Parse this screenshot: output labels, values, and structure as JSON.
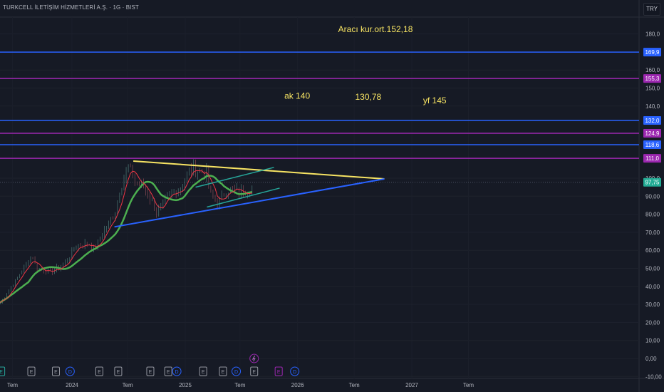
{
  "header": {
    "title": "TURKCELL İLETİŞİM HİZMETLERİ A.Ş. · 1G · BIST",
    "currency": "TRY"
  },
  "colors": {
    "background": "#161a25",
    "blue": "#2962ff",
    "purple": "#9c27b0",
    "yellow": "#f7e463",
    "green_line": "#26a69a",
    "ma_slow": "#4caf50",
    "ma_fast": "#f23645",
    "last_price": "#22ab94"
  },
  "chart_data": {
    "type": "candlestick",
    "time_unit": "months since 2023-01",
    "xlim": [
      -4.4,
      63.3
    ],
    "ylim": [
      -10,
      188
    ],
    "y_ticks": [
      "180,0",
      "160,0",
      "150,0",
      "140,0",
      "100,0",
      "90,00",
      "80,00",
      "70,00",
      "60,00",
      "50,00",
      "40,00",
      "30,00",
      "20,00",
      "10,00",
      "0,00",
      "-10,00"
    ],
    "y_tick_values": [
      180,
      160,
      150,
      140,
      100,
      90,
      80,
      70,
      60,
      50,
      40,
      30,
      20,
      10,
      0,
      -10
    ],
    "x_ticks": [
      {
        "label": "Tem",
        "t": 5.7
      },
      {
        "label": "2024",
        "t": 12
      },
      {
        "label": "Tem",
        "t": 17.9
      },
      {
        "label": "2025",
        "t": 24
      },
      {
        "label": "Tem",
        "t": 29.8
      },
      {
        "label": "2026",
        "t": 35.9
      },
      {
        "label": "Tem",
        "t": 41.9
      },
      {
        "label": "2027",
        "t": 48
      },
      {
        "label": "Tem",
        "t": 54
      }
    ],
    "price_path": [
      [
        4.4,
        31
      ],
      [
        7.8,
        57
      ],
      [
        8.2,
        50
      ],
      [
        9.7,
        48
      ],
      [
        11.2,
        52
      ],
      [
        12.3,
        62
      ],
      [
        13.8,
        64
      ],
      [
        14.4,
        60
      ],
      [
        15.3,
        70
      ],
      [
        16.5,
        80
      ],
      [
        17.2,
        96
      ],
      [
        18.0,
        107
      ],
      [
        18.7,
        98
      ],
      [
        19.5,
        96
      ],
      [
        20.6,
        86
      ],
      [
        21.0,
        80
      ],
      [
        21.7,
        86
      ],
      [
        22.5,
        91
      ],
      [
        23.6,
        95
      ],
      [
        24.4,
        104
      ],
      [
        25.1,
        105
      ],
      [
        26.3,
        102
      ],
      [
        26.6,
        92
      ],
      [
        27.4,
        86
      ],
      [
        28.5,
        94
      ],
      [
        30.0,
        92
      ],
      [
        31.2,
        95
      ]
    ],
    "horizontal_levels": [
      {
        "value": 169.9,
        "label": "169,9",
        "color": "#2962ff"
      },
      {
        "value": 155.3,
        "label": "155,3",
        "color": "#9c27b0"
      },
      {
        "value": 132.0,
        "label": "132,0",
        "color": "#2962ff"
      },
      {
        "value": 124.9,
        "label": "124,9",
        "color": "#9c27b0"
      },
      {
        "value": 118.6,
        "label": "118,6",
        "color": "#2962ff"
      },
      {
        "value": 111.0,
        "label": "111,0",
        "color": "#9c27b0"
      }
    ],
    "last_price": {
      "value": 97.75,
      "label": "97,75"
    },
    "trend_lines": [
      {
        "name": "resistance",
        "color": "#f7e463",
        "from": [
          18.5,
          109.5
        ],
        "to": [
          45.1,
          99.6
        ]
      },
      {
        "name": "support",
        "color": "#2962ff",
        "from": [
          16.5,
          73
        ],
        "to": [
          45.1,
          99.6
        ]
      },
      {
        "name": "channel-upper",
        "color": "#26a69a",
        "from": [
          25.1,
          95
        ],
        "to": [
          33.4,
          106
        ]
      },
      {
        "name": "channel-lower",
        "color": "#26a69a",
        "from": [
          26.3,
          84
        ],
        "to": [
          34.0,
          94.5
        ]
      }
    ],
    "annotations": [
      {
        "text": "Aracı kur.ort.152,18",
        "t": 40.2,
        "value": 181
      },
      {
        "text": "ak 140",
        "t": 34.5,
        "value": 144
      },
      {
        "text": "130,78",
        "t": 42.0,
        "value": 143.5
      },
      {
        "text": "yf 145",
        "t": 49.2,
        "value": 141.5
      }
    ],
    "events": [
      {
        "type": "E",
        "t": 4.5,
        "color": "#26a69a"
      },
      {
        "type": "E",
        "t": 7.7
      },
      {
        "type": "E",
        "t": 10.3
      },
      {
        "type": "D",
        "t": 11.8
      },
      {
        "type": "E",
        "t": 14.9
      },
      {
        "type": "E",
        "t": 16.9
      },
      {
        "type": "E",
        "t": 20.3
      },
      {
        "type": "E",
        "t": 22.2
      },
      {
        "type": "D",
        "t": 23.1
      },
      {
        "type": "E",
        "t": 25.9
      },
      {
        "type": "E",
        "t": 28.0
      },
      {
        "type": "D",
        "t": 29.4
      },
      {
        "type": "E",
        "t": 31.3
      },
      {
        "type": "E",
        "t": 33.9,
        "color": "#9c27b0"
      },
      {
        "type": "D",
        "t": 35.6
      }
    ],
    "flash_event": {
      "t": 31.3
    }
  }
}
